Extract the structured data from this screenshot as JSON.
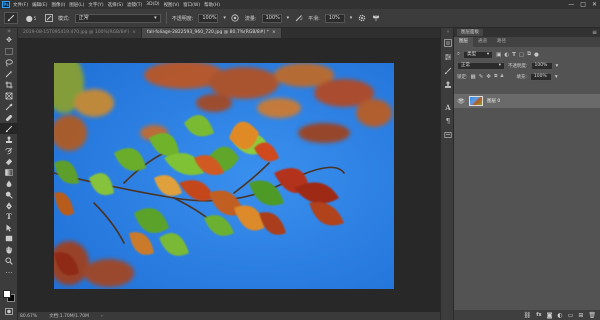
{
  "app": {
    "logo_text": "Ps"
  },
  "menubar": {
    "items": [
      "文件(F)",
      "编辑(E)",
      "图像(I)",
      "图层(L)",
      "文字(Y)",
      "选择(S)",
      "滤镜(T)",
      "3D(D)",
      "视图(V)",
      "窗口(W)",
      "帮助(H)"
    ],
    "window_controls": [
      "—",
      "□",
      "✕"
    ]
  },
  "options_bar": {
    "brush_size": "5",
    "mode_label": "模式:",
    "mode_value": "正常",
    "opacity_label": "不透明度:",
    "opacity_value": "100%",
    "flow_label": "流量:",
    "flow_value": "100%",
    "smoothing_label": "平滑:",
    "smoothing_value": "10%"
  },
  "tabs": [
    {
      "title": "2019-08-15T095419.470.jpg @ 100%(RGB/8#)",
      "active": false,
      "close": "×"
    },
    {
      "title": "fall-foliage-2822593_960_720.jpg @ 80.7%(RGB/8#) *",
      "active": true,
      "close": "×"
    }
  ],
  "status": {
    "zoom": "80.67%",
    "doc": "文档:1.70M/1.70M"
  },
  "panel": {
    "header_title": "图层面板",
    "tabs": [
      "图层",
      "通道",
      "路径"
    ],
    "filter_kind": "类型",
    "blend_mode": "正常",
    "opacity_label": "不透明度:",
    "opacity_value": "100%",
    "lock_label": "锁定:",
    "fill_label": "填充:",
    "fill_value": "100%",
    "layer_name": "图层 0"
  },
  "colors": {
    "sky": "#2b84ea",
    "canvas_bg": "#282828",
    "workspace": "#535353"
  }
}
